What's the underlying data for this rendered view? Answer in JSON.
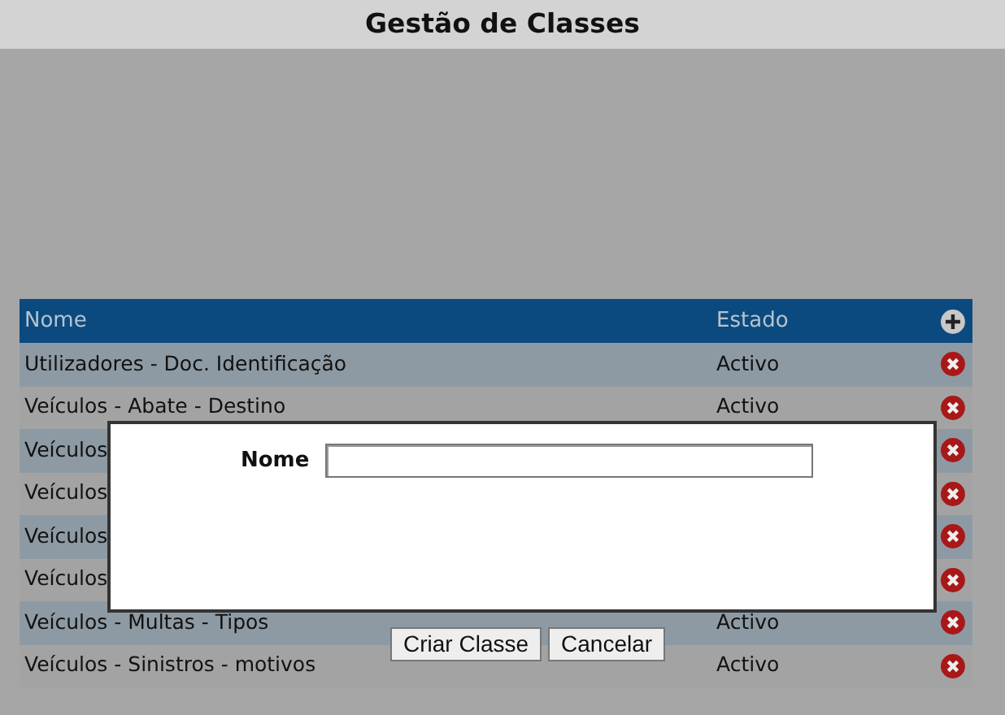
{
  "title": "Gestão de Classes",
  "table": {
    "columns": [
      "Nome",
      "Estado"
    ],
    "rows": [
      {
        "name": "Utilizadores - Doc. Identificação",
        "status": "Activo"
      },
      {
        "name": "Veículos - Abate - Destino",
        "status": "Activo"
      },
      {
        "name": "Veículos"
      },
      {
        "name": "Veículos"
      },
      {
        "name": "Veículos"
      },
      {
        "name": "Veículos"
      },
      {
        "name": "Veículos - Multas - Tipos",
        "status": "Activo"
      },
      {
        "name": "Veículos - Sinistros - motivos",
        "status": "Activo"
      }
    ]
  },
  "dialog": {
    "field_label": "Nome",
    "buttons": [
      "Criar Classe",
      "Cancelar"
    ]
  }
}
